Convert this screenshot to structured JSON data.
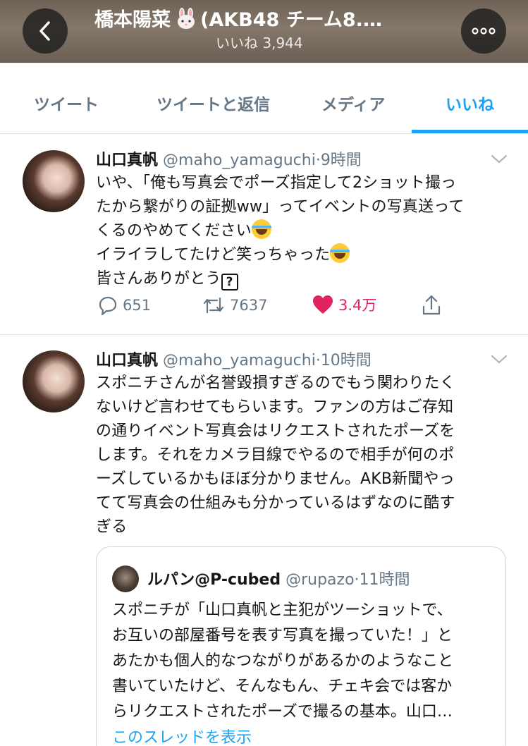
{
  "header": {
    "title_prefix": "橋本陽菜",
    "title_suffix": "(AKB48 チーム8.…",
    "subtitle": "いいね 3,944"
  },
  "tabs": [
    {
      "label": "ツイート",
      "active": false
    },
    {
      "label": "ツイートと返信",
      "active": false
    },
    {
      "label": "メディア",
      "active": false
    },
    {
      "label": "いいね",
      "active": true
    }
  ],
  "colors": {
    "accent": "#1da1f2",
    "like": "#e0245e",
    "muted": "#657786"
  },
  "tweets": [
    {
      "name": "山口真帆",
      "handle": "@maho_yamaguchi",
      "sep": "·",
      "time": "9時間",
      "lines": [
        "いや、「俺も写真会でポーズ指定して2ショット撮っ",
        "たから繋がりの証拠ww」ってイベントの写真送って",
        "くるのやめてください",
        "イライラしてたけど笑っちゃった",
        "皆さんありがとう"
      ],
      "emoji": "face-with-tears-of-joy",
      "unknown_glyph": "?",
      "replies": "651",
      "retweets": "7637",
      "likes": "3.4万"
    },
    {
      "name": "山口真帆",
      "handle": "@maho_yamaguchi",
      "sep": "·",
      "time": "10時間",
      "lines": [
        "スポニチさんが名誉毀損すぎるのでもう関わりたく",
        "ないけど言わせてもらいます。ファンの方はご存知",
        "の通りイベント写真会はリクエストされたポーズを",
        "します。それをカメラ目線でやるので相手が何のポ",
        "ーズしているかもほぼ分かりません。AKB新聞やっ",
        "てて写真会の仕組みも分かっているはずなのに酷す",
        "ぎる"
      ],
      "quote": {
        "name": "ルパン@P-cubed",
        "handle": "@rupazo",
        "sep": "·",
        "time": "11時間",
        "lines": [
          "スポニチが「山口真帆と主犯がツーショットで、",
          "お互いの部屋番号を表す写真を撮っていた！」と",
          "あたかも個人的なつながりがあるかのようなこと",
          "書いていたけど、そんなもん、チェキ会では客か",
          "らリクエストされたポーズで撮るの基本。山口…"
        ],
        "show_thread": "このスレッドを表示"
      }
    }
  ]
}
